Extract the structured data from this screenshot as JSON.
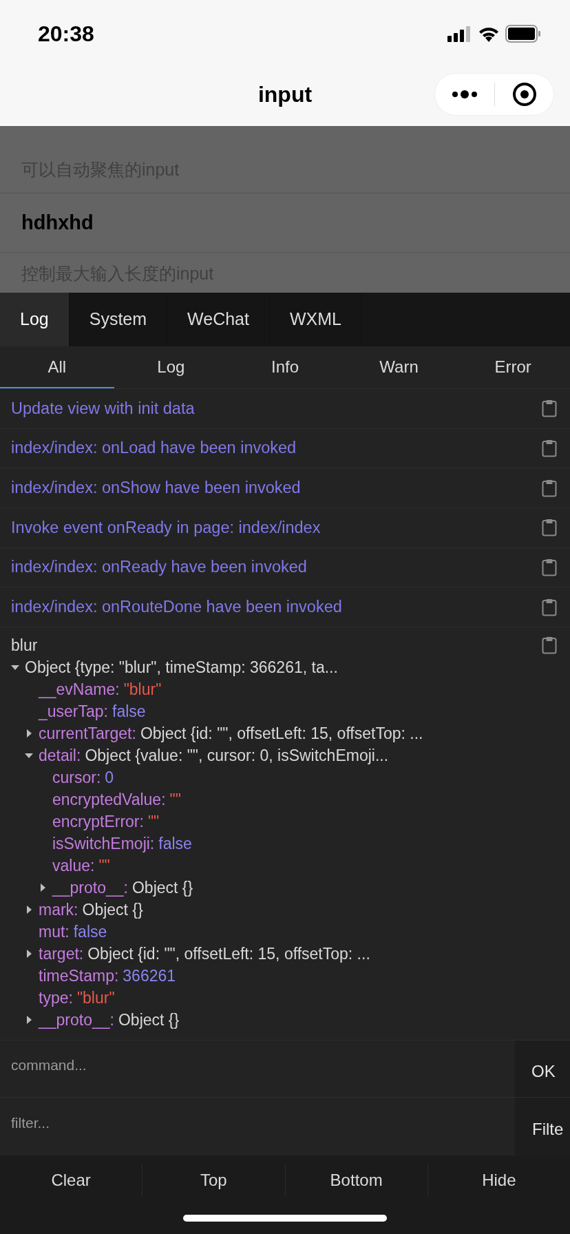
{
  "status_bar": {
    "time": "20:38"
  },
  "nav": {
    "title": "input"
  },
  "page": {
    "items": [
      {
        "kind": "label",
        "text": "可以自动聚焦的input"
      },
      {
        "kind": "value",
        "text": "hdhxhd"
      },
      {
        "kind": "label",
        "text": "控制最大输入长度的input"
      }
    ]
  },
  "tabs": [
    {
      "label": "Log",
      "selected": true
    },
    {
      "label": "System",
      "selected": false
    },
    {
      "label": "WeChat",
      "selected": false
    },
    {
      "label": "WXML",
      "selected": false
    }
  ],
  "filters": [
    {
      "label": "All",
      "selected": true
    },
    {
      "label": "Log",
      "selected": false
    },
    {
      "label": "Info",
      "selected": false
    },
    {
      "label": "Warn",
      "selected": false
    },
    {
      "label": "Error",
      "selected": false
    }
  ],
  "logs": [
    "Update view with init data",
    "index/index: onLoad have been invoked",
    "index/index: onShow have been invoked",
    "Invoke event onReady in page: index/index",
    "index/index: onReady have been invoked",
    "index/index: onRouteDone have been invoked"
  ],
  "event": {
    "title": "blur",
    "tree": {
      "summary": "Object {type: \"blur\", timeStamp: 366261, ta...",
      "expanded": true,
      "children": [
        {
          "key": "__evName:",
          "value": "\"blur\"",
          "kind": "string"
        },
        {
          "key": "_userTap:",
          "value": "false",
          "kind": "boolean"
        },
        {
          "key": "currentTarget:",
          "value": "Object {id: \"\", offsetLeft: 15, offsetTop: ...",
          "kind": "object",
          "expanded": false
        },
        {
          "key": "detail:",
          "value": "Object {value: \"\", cursor: 0, isSwitchEmoji...",
          "kind": "object",
          "expanded": true,
          "children": [
            {
              "key": "cursor:",
              "value": "0",
              "kind": "number"
            },
            {
              "key": "encryptedValue:",
              "value": "\"\"",
              "kind": "string"
            },
            {
              "key": "encryptError:",
              "value": "\"\"",
              "kind": "string"
            },
            {
              "key": "isSwitchEmoji:",
              "value": "false",
              "kind": "boolean"
            },
            {
              "key": "value:",
              "value": "\"\"",
              "kind": "string"
            },
            {
              "key": "__proto__:",
              "value": "Object {}",
              "kind": "object",
              "expanded": false
            }
          ]
        },
        {
          "key": "mark:",
          "value": "Object {}",
          "kind": "object",
          "expanded": false
        },
        {
          "key": "mut:",
          "value": "false",
          "kind": "boolean"
        },
        {
          "key": "target:",
          "value": "Object {id: \"\", offsetLeft: 15, offsetTop: ...",
          "kind": "object",
          "expanded": false
        },
        {
          "key": "timeStamp:",
          "value": "366261",
          "kind": "number"
        },
        {
          "key": "type:",
          "value": "\"blur\"",
          "kind": "string"
        },
        {
          "key": "__proto__:",
          "value": "Object {}",
          "kind": "object",
          "expanded": false
        }
      ]
    }
  },
  "command": {
    "placeholder": "command...",
    "button": "OK"
  },
  "filter": {
    "placeholder": "filter...",
    "button": "Filte"
  },
  "actions": [
    "Clear",
    "Top",
    "Bottom",
    "Hide"
  ]
}
